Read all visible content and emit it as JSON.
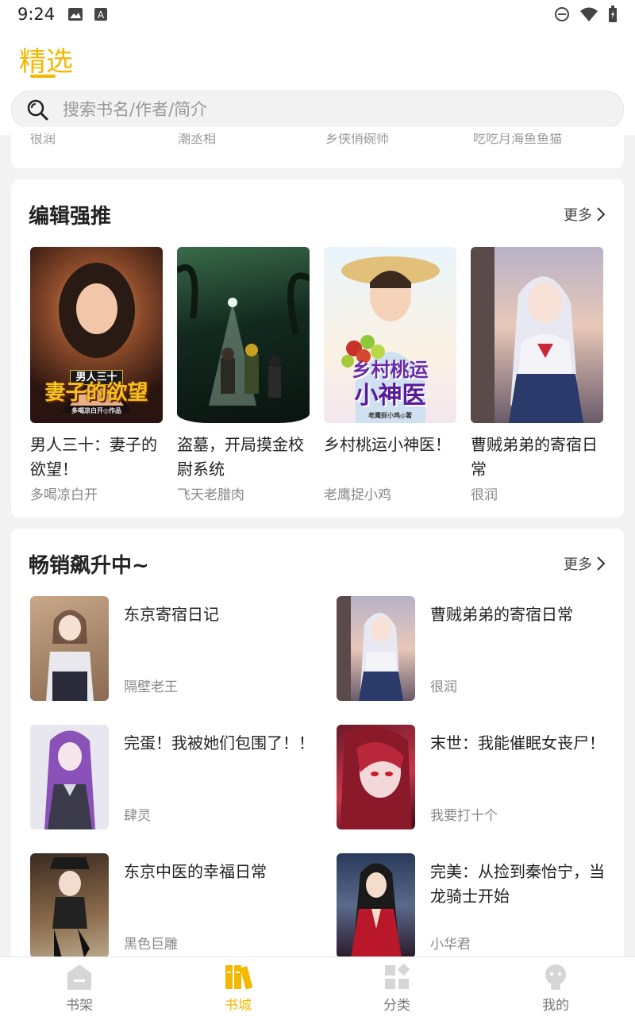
{
  "status": {
    "time": "9:24"
  },
  "header": {
    "tab_title": "精选",
    "search_placeholder": "搜索书名/作者/简介"
  },
  "previous_section": {
    "authors": [
      "很润",
      "潮丞相",
      "乡侠俏碗师",
      "吃吃月海鱼鱼猫"
    ]
  },
  "editor_picks": {
    "title": "编辑强推",
    "more": "更多",
    "books": [
      {
        "name": "男人三十：妻子的欲望！",
        "author": "多喝凉白开",
        "cover_text_top": "男人三十",
        "cover_text": "妻子的欲望",
        "cover_byline": "多喝凉白开◎作品"
      },
      {
        "name": "盗墓，开局摸金校尉系统",
        "author": "飞天老腊肉"
      },
      {
        "name": "乡村桃运小神医！",
        "author": "老鹰捉小鸡",
        "cover_text_top": "乡村桃运",
        "cover_text": "小神医",
        "cover_byline": "老鹰捉小鸡◎著"
      },
      {
        "name": "曹贼弟弟的寄宿日常",
        "author": "很润"
      }
    ]
  },
  "hot": {
    "title": "畅销飙升中~",
    "more": "更多",
    "books": [
      {
        "name": "东京寄宿日记",
        "author": "隔壁老王"
      },
      {
        "name": "曹贼弟弟的寄宿日常",
        "author": "很润"
      },
      {
        "name": "完蛋！我被她们包围了！！",
        "author": "肆灵"
      },
      {
        "name": "末世：我能催眠女丧尸！",
        "author": "我要打十个"
      },
      {
        "name": "东京中医的幸福日常",
        "author": "黑色巨雕"
      },
      {
        "name": "完美：从捡到秦怡宁，当龙骑士开始",
        "author": "小华君"
      }
    ]
  },
  "nav": [
    {
      "label": "书架",
      "icon": "bookshelf-icon"
    },
    {
      "label": "书城",
      "icon": "bookstore-icon",
      "active": true
    },
    {
      "label": "分类",
      "icon": "category-icon"
    },
    {
      "label": "我的",
      "icon": "profile-icon"
    }
  ],
  "colors": {
    "accent": "#f5b800"
  }
}
